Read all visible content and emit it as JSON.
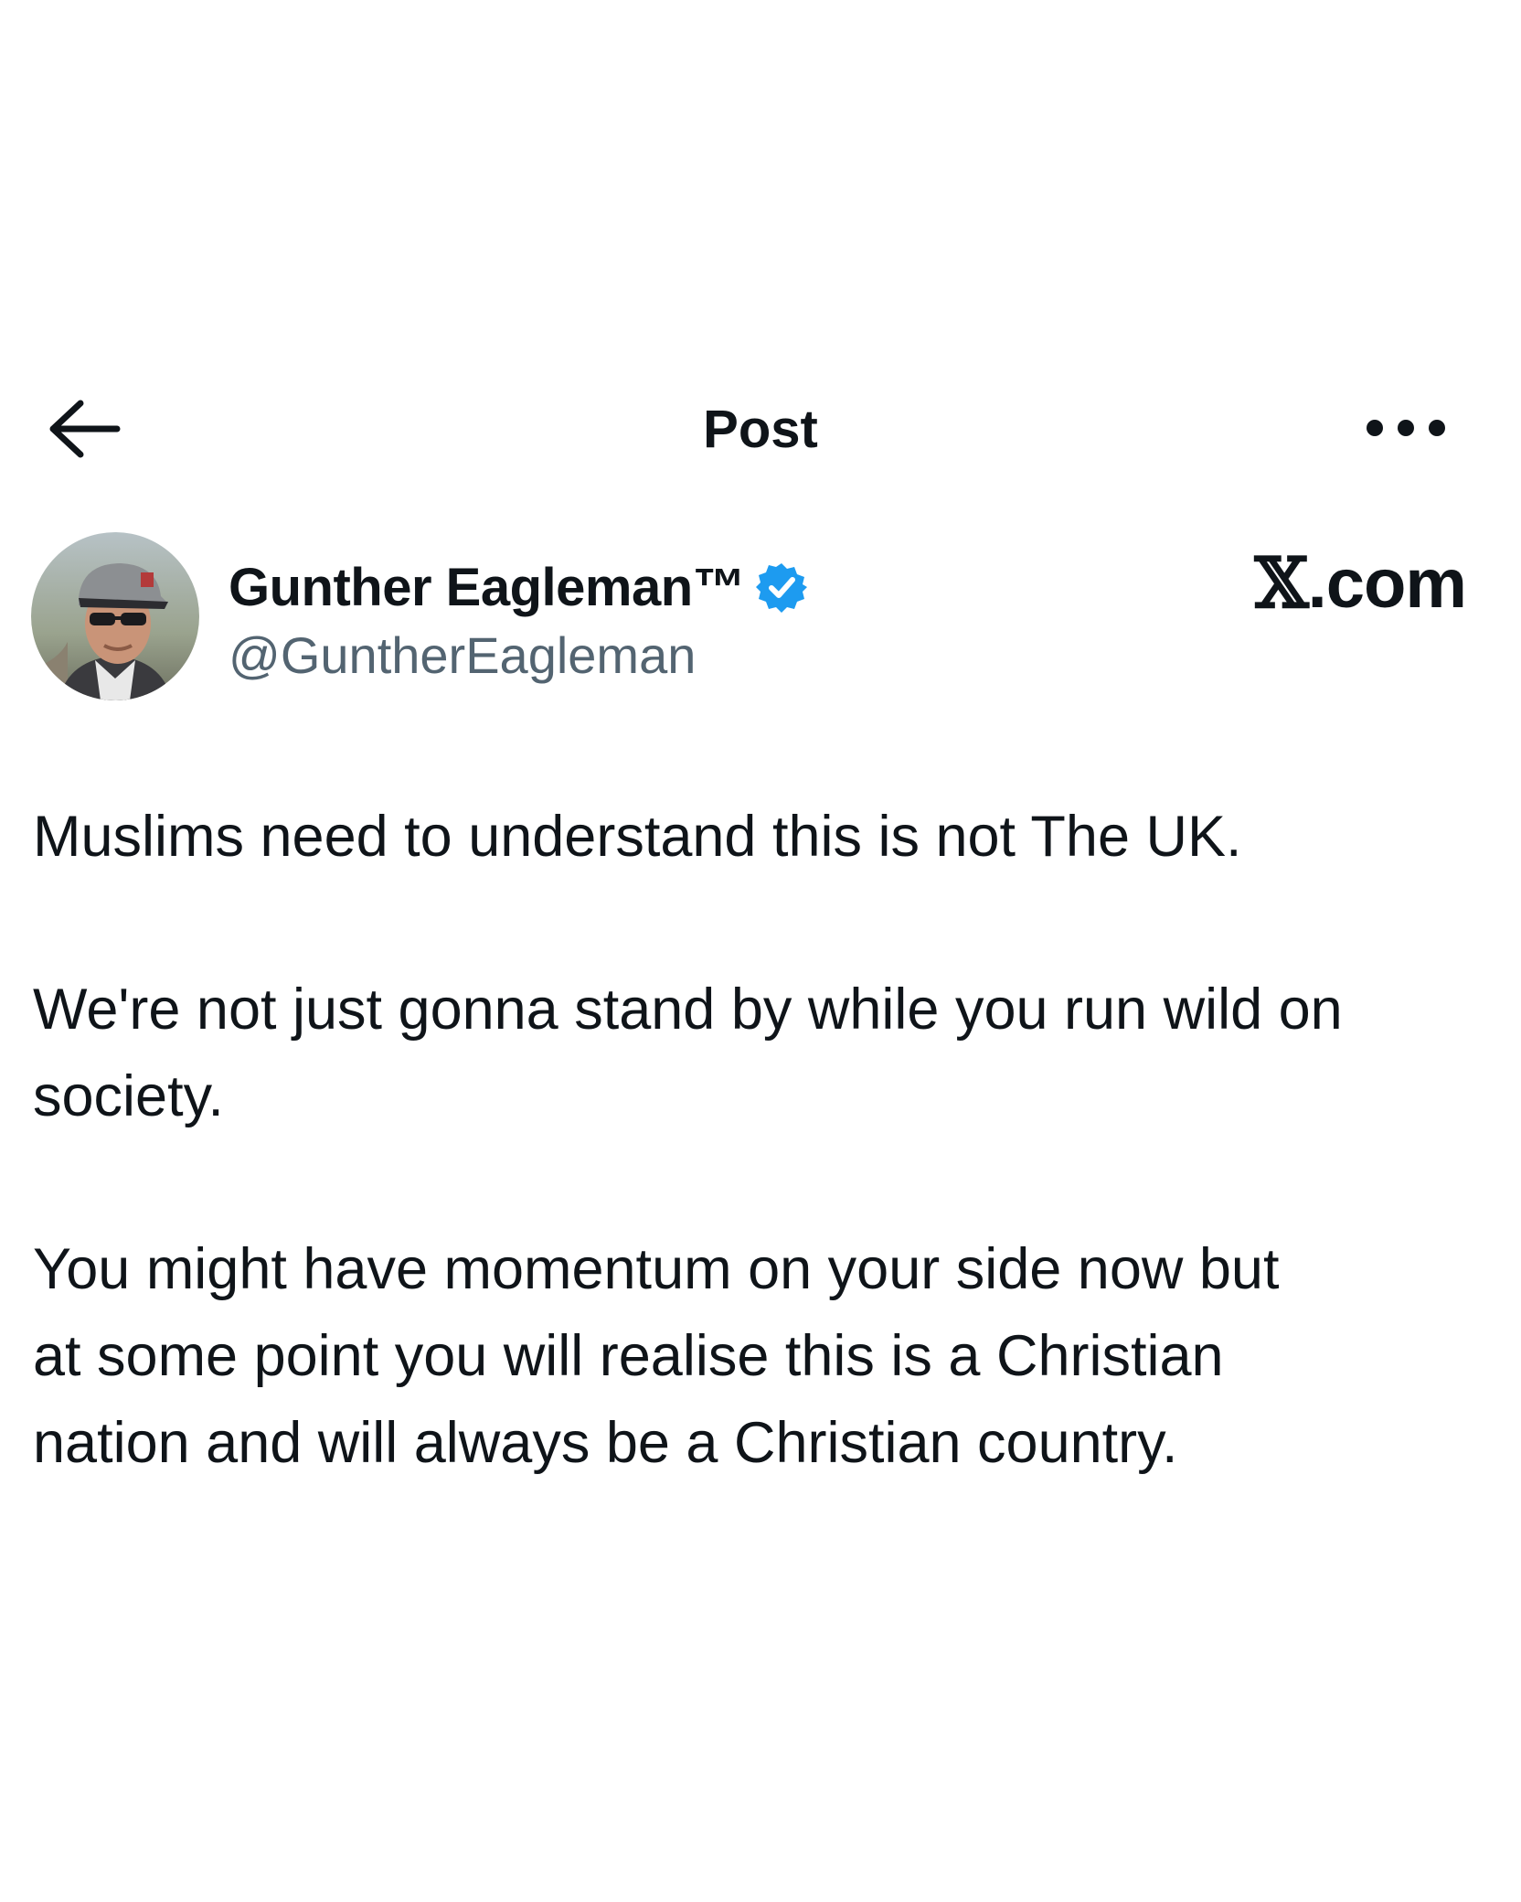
{
  "header": {
    "title": "Post",
    "back_icon": "arrow-left-icon",
    "more_icon": "more-horizontal-icon"
  },
  "author": {
    "display_name": "Gunther Eagleman™",
    "handle": "@GuntherEagleman",
    "verified": true,
    "verified_color": "#1d9bf0"
  },
  "brand": {
    "logo_letter": "𝕏",
    "domain_suffix": ".com"
  },
  "post": {
    "paragraphs": [
      "Muslims need to understand this is not The UK.",
      "We're not just gonna stand by while you run wild on\nsociety.",
      "You might have momentum on your side now but\nat some point you will realise this is a Christian\nnation and will always be a Christian country."
    ]
  }
}
